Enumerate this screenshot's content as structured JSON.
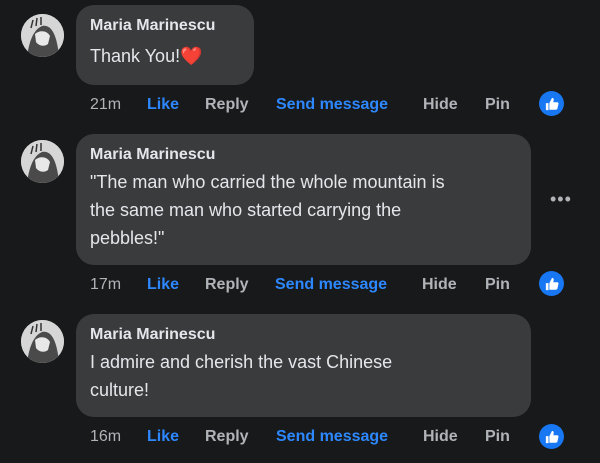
{
  "comments": [
    {
      "author": "Maria Marinescu",
      "text": "Thank You!",
      "reaction_emoji": "❤️",
      "time": "21m"
    },
    {
      "author": "Maria Marinescu",
      "text_lines": [
        "\"The man who carried the whole mountain is",
        "the same man who started carrying the",
        "pebbles!\""
      ],
      "time": "17m"
    },
    {
      "author": "Maria Marinescu",
      "text_lines": [
        "I admire and cherish the vast Chinese",
        "culture!"
      ],
      "time": "16m"
    }
  ],
  "actions": {
    "like": "Like",
    "reply": "Reply",
    "send_message": "Send message",
    "hide": "Hide",
    "pin": "Pin"
  },
  "icons": {
    "like_badge": "thumbs-up-icon",
    "more": "more-options-icon",
    "avatar": "user-avatar"
  },
  "colors": {
    "background": "#18191a",
    "bubble": "#3a3b3c",
    "text": "#e4e6eb",
    "muted": "#b0b3b8",
    "link_blue": "#2d88ff",
    "like_badge": "#1877f2",
    "heart": "#f02849"
  }
}
